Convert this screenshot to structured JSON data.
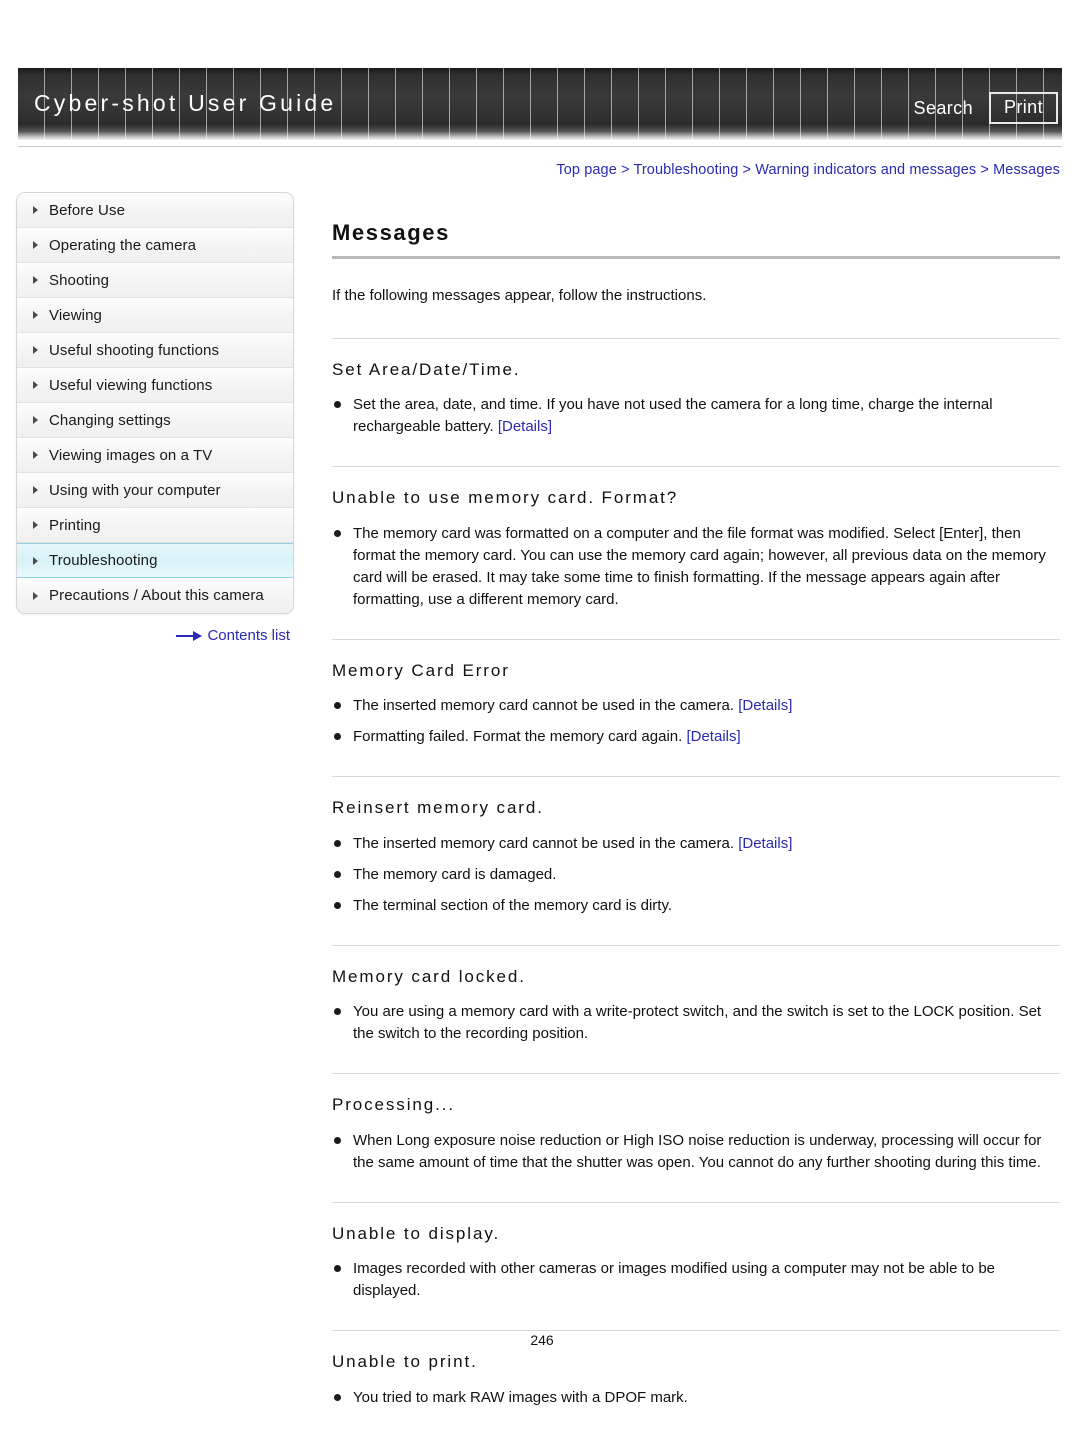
{
  "header": {
    "title": "Cyber-shot User Guide",
    "search_label": "Search",
    "print_label": "Print"
  },
  "breadcrumb": {
    "items": [
      {
        "label": "Top page"
      },
      {
        "label": "Troubleshooting"
      },
      {
        "label": "Warning indicators and messages"
      },
      {
        "label": "Messages"
      }
    ],
    "separator": ">"
  },
  "sidebar": {
    "items": [
      {
        "label": "Before Use",
        "active": false
      },
      {
        "label": "Operating the camera",
        "active": false
      },
      {
        "label": "Shooting",
        "active": false
      },
      {
        "label": "Viewing",
        "active": false
      },
      {
        "label": "Useful shooting functions",
        "active": false
      },
      {
        "label": "Useful viewing functions",
        "active": false
      },
      {
        "label": "Changing settings",
        "active": false
      },
      {
        "label": "Viewing images on a TV",
        "active": false
      },
      {
        "label": "Using with your computer",
        "active": false
      },
      {
        "label": "Printing",
        "active": false
      },
      {
        "label": "Troubleshooting",
        "active": true
      },
      {
        "label": "Precautions / About this camera",
        "active": false
      }
    ],
    "contents_list_label": "Contents list"
  },
  "main": {
    "title": "Messages",
    "intro": "If the following messages appear, follow the instructions.",
    "details_label": "[Details]",
    "sections": [
      {
        "title": "Set Area/Date/Time.",
        "bullets": [
          {
            "text": "Set the area, date, and time. If you have not used the camera for a long time, charge the internal rechargeable battery. ",
            "link": "[Details]"
          }
        ]
      },
      {
        "title": "Unable to use memory card. Format?",
        "bullets": [
          {
            "text": "The memory card was formatted on a computer and the file format was modified. Select [Enter], then format the memory card. You can use the memory card again; however, all previous data on the memory card will be erased. It may take some time to finish formatting. If the message appears again after formatting, use a different memory card.",
            "link": ""
          }
        ]
      },
      {
        "title": "Memory Card Error",
        "bullets": [
          {
            "text": "The inserted memory card cannot be used in the camera. ",
            "link": "[Details]"
          },
          {
            "text": "Formatting failed. Format the memory card again. ",
            "link": "[Details]"
          }
        ]
      },
      {
        "title": "Reinsert memory card.",
        "bullets": [
          {
            "text": "The inserted memory card cannot be used in the camera. ",
            "link": "[Details]"
          },
          {
            "text": "The memory card is damaged.",
            "link": ""
          },
          {
            "text": "The terminal section of the memory card is dirty.",
            "link": ""
          }
        ]
      },
      {
        "title": "Memory card locked.",
        "bullets": [
          {
            "text": "You are using a memory card with a write-protect switch, and the switch is set to the LOCK position. Set the switch to the recording position.",
            "link": ""
          }
        ]
      },
      {
        "title": "Processing...",
        "bullets": [
          {
            "text": "When Long exposure noise reduction or High ISO noise reduction is underway, processing will occur for the same amount of time that the shutter was open. You cannot do any further shooting during this time.",
            "link": ""
          }
        ]
      },
      {
        "title": "Unable to display.",
        "bullets": [
          {
            "text": "Images recorded with other cameras or images modified using a computer may not be able to be displayed.",
            "link": ""
          }
        ]
      },
      {
        "title": "Unable to print.",
        "bullets": [
          {
            "text": "You tried to mark RAW images with a DPOF mark.",
            "link": ""
          }
        ]
      }
    ]
  },
  "footer": {
    "page_number": "246"
  },
  "colors": {
    "link": "#2a2ab4",
    "header_text": "#ffffff",
    "active_nav_bg": "#ddf4fa",
    "active_nav_border": "#8fd4e2"
  }
}
